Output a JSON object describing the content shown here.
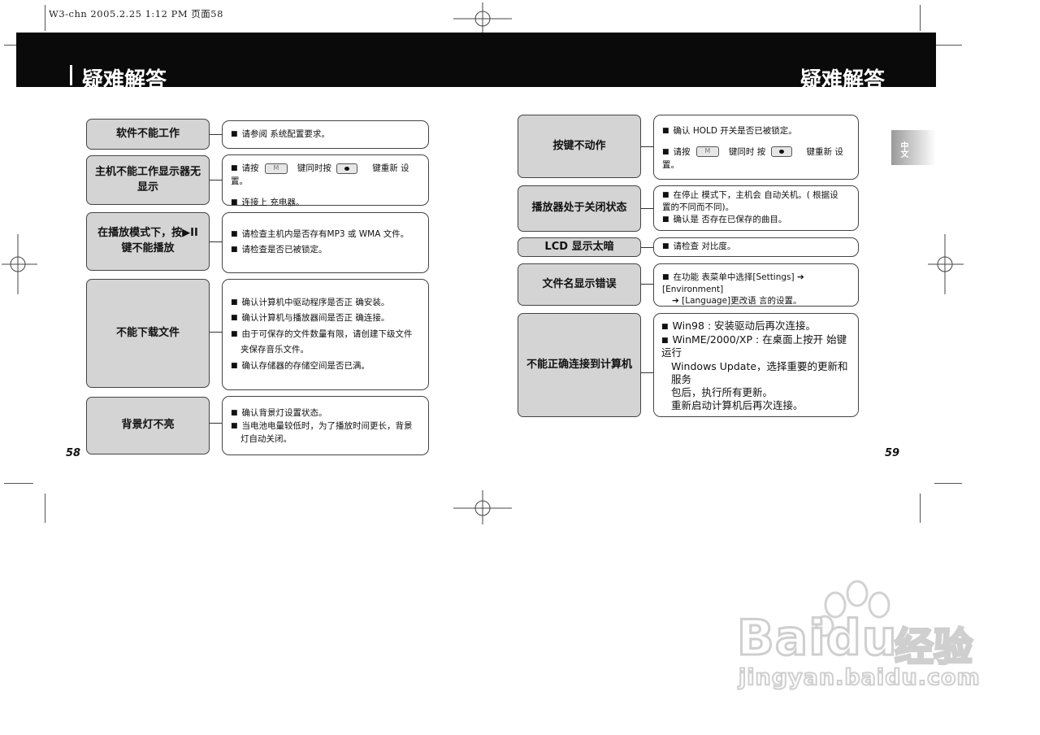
{
  "print_header": "W3-chn  2005.2.25 1:12 PM  页面58",
  "title": {
    "left": "疑难解答",
    "right": "疑难解答"
  },
  "side_tab": "中文",
  "page_numbers": {
    "left": "58",
    "right": "59"
  },
  "left_page": {
    "rows": [
      {
        "topic": "软件不能工作",
        "answers": [
          "请参阅 系统配置要求。"
        ]
      },
      {
        "topic": "主机不能工作显示器无显示",
        "key_line": {
          "before": "请按",
          "key1": "M",
          "middle": "键同时按",
          "after": "键重新 设置。"
        },
        "answers": [
          "连接上 充电器。"
        ]
      },
      {
        "topic": "在播放模式下，按▶II 键不能播放",
        "answers": [
          "请检查主机内是否存有MP3 或 WMA  文件。",
          "请检查是否已被锁定。"
        ]
      },
      {
        "topic": "不能下载文件",
        "answers": [
          "确认计算机中驱动程序是否正 确安装。",
          "确认计算机与播放器间是否正 确连接。",
          "由于可保存的文件数量有限，请创建下级文件",
          "确认存储器的存储空间是否已满。"
        ],
        "continuation": "夹保存音乐文件。"
      },
      {
        "topic": "背景灯不亮",
        "answers": [
          "确认背景灯设置状态。",
          "当电池电量较低时，为了播放时间更长，背景"
        ],
        "continuation": "灯自动关闭。"
      }
    ]
  },
  "right_page": {
    "rows": [
      {
        "topic": "按键不动作",
        "answers": [
          "确认 HOLD  开关是否已被锁定。"
        ],
        "key_line": {
          "before": "请按",
          "key1": "M",
          "middle": "键同时 按",
          "after": "键重新 设置。"
        }
      },
      {
        "topic": "播放器处于关闭状态",
        "answers": [
          "在停止 模式下，主机会 自动关机。(  根据设",
          "确认是 否存在已保存的曲目。"
        ],
        "continuation": "置的不同而不同)。"
      },
      {
        "topic": "LCD 显示太暗",
        "answers": [
          "请检查 对比度。"
        ]
      },
      {
        "topic": "文件名显示错误",
        "answers": [
          "在功能 表菜单中选择[Settings] ➔ [Environment]"
        ],
        "continuation": "➔ [Language]更改语 言的设置。"
      },
      {
        "topic": "不能正确连接到计算机",
        "answers": [
          "Win98 : 安装驱动后再次连接。",
          "WinME/2000/XP : 在桌面上按开 始键运行"
        ],
        "continuation": [
          "Windows Update，选择重要的更新和服务",
          "包后，执行所有更新。",
          "重新启动计算机后再次连接。"
        ]
      }
    ]
  },
  "watermark": {
    "brand": "Baidu",
    "cn": "经验",
    "url": "jingyan.baidu.com"
  }
}
